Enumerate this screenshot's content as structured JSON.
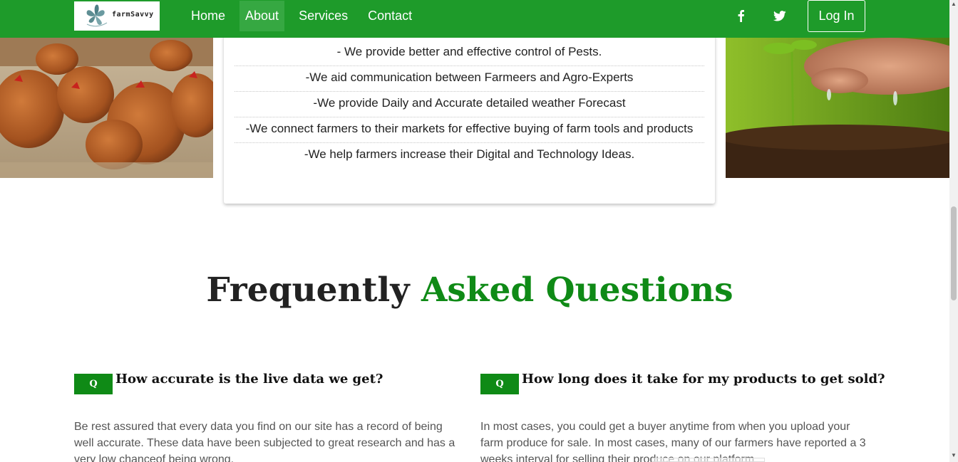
{
  "brand": {
    "logo_text": "farmSavvy"
  },
  "nav": {
    "links": [
      {
        "label": "Home",
        "active": false
      },
      {
        "label": "About",
        "active": true
      },
      {
        "label": "Services",
        "active": false
      },
      {
        "label": "Contact",
        "active": false
      }
    ],
    "social": {
      "facebook_icon": "f",
      "twitter_icon": "twitter-bird"
    },
    "login_label": "Log In"
  },
  "services": [
    "- We provide better and effective control of Pests.",
    "-We aid communication between Farmeers and Agro-Experts",
    "-We provide Daily and Accurate detailed weather Forecast",
    "-We connect farmers to their markets for effective buying of farm tools and products",
    "-We help farmers increase their Digital and Technology Ideas."
  ],
  "faq": {
    "title_plain": "Frequently ",
    "title_accent": "Asked Questions",
    "items": [
      {
        "badge": "Q",
        "question": "How accurate is the live data we get?",
        "answer": "Be rest assured that every data you find on our site has a record of being well accurate. These data have been subjected to great research and has a very low chanceof being wrong."
      },
      {
        "badge": "Q",
        "question": "How long does it take for my products to get sold?",
        "answer": "In most cases, you could get a buyer anytime from when you upload your farm produce for sale. In most cases, many of our farmers have reported a 3 weeks interval for selling their produce on our platform."
      }
    ]
  },
  "colors": {
    "navbar": "#1e9b2a",
    "accent_green": "#0f8a16"
  }
}
